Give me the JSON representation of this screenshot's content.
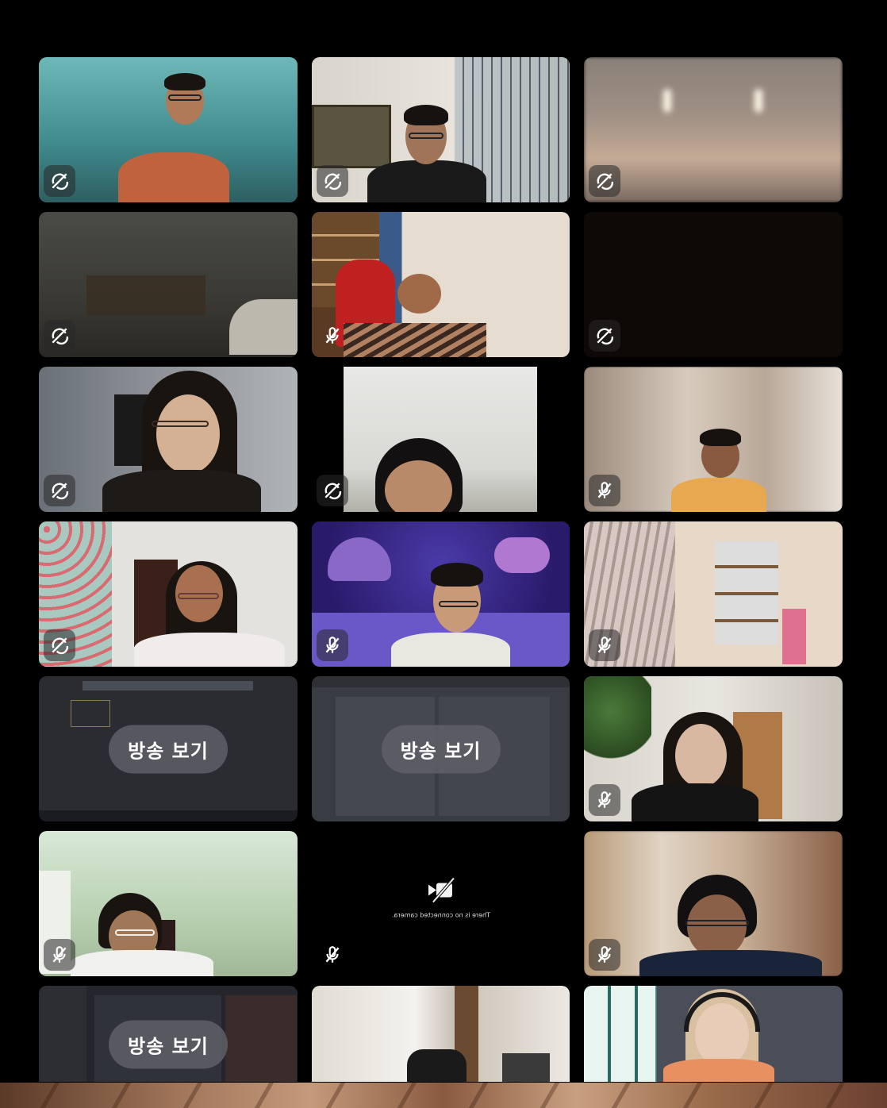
{
  "app": {
    "accent": "#5f5f69",
    "background": "#000000"
  },
  "tiles": [
    {
      "id": 1,
      "mic": "camera-off-icon"
    },
    {
      "id": 2,
      "mic": "camera-off-icon"
    },
    {
      "id": 3,
      "mic": "camera-off-icon"
    },
    {
      "id": 4,
      "mic": "camera-off-icon"
    },
    {
      "id": 5,
      "mic": "mic-off-icon"
    },
    {
      "id": 6,
      "mic": "camera-off-icon"
    },
    {
      "id": 7,
      "mic": "camera-off-icon"
    },
    {
      "id": 8,
      "mic": "camera-off-icon"
    },
    {
      "id": 9,
      "mic": "mic-off-icon"
    },
    {
      "id": 10,
      "mic": "camera-off-icon"
    },
    {
      "id": 11,
      "mic": "mic-off-icon"
    },
    {
      "id": 12,
      "mic": "mic-off-icon"
    },
    {
      "id": 13,
      "watch_label": "방송 보기"
    },
    {
      "id": 14,
      "watch_label": "방송 보기"
    },
    {
      "id": 15,
      "mic": "mic-off-icon"
    },
    {
      "id": 16,
      "mic": "mic-off-icon"
    },
    {
      "id": 17,
      "mic": "mic-off-icon",
      "no_camera_text": "There is no connected camera."
    },
    {
      "id": 18,
      "mic": "mic-off-icon"
    },
    {
      "id": 19,
      "watch_label": "방송 보기"
    },
    {
      "id": 20
    },
    {
      "id": 21
    }
  ]
}
